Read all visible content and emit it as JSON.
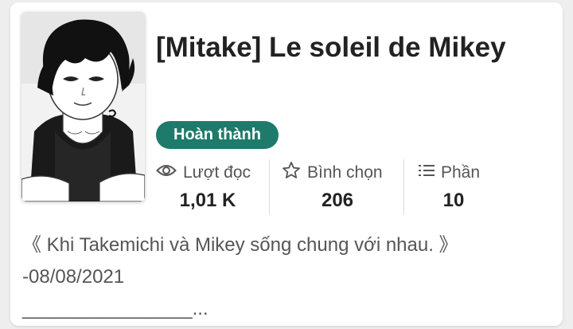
{
  "story": {
    "title": "[Mitake] Le soleil de Mikey",
    "status_badge": "Hoàn thành",
    "cover_alt": "cover-image"
  },
  "stats": {
    "reads_label": "Lượt đọc",
    "reads_value": "1,01 K",
    "votes_label": "Bình chọn",
    "votes_value": "206",
    "parts_label": "Phần",
    "parts_value": "10"
  },
  "description": {
    "line1": "《 Khi Takemichi và Mikey sống chung với nhau. 》",
    "line2": "-08/08/2021",
    "line3": "________________..."
  },
  "colors": {
    "badge": "#1e7a6a",
    "text_dark": "#222222",
    "text_muted": "#555555"
  },
  "icons": {
    "reads": "eye-icon",
    "votes": "star-icon",
    "parts": "list-icon"
  }
}
